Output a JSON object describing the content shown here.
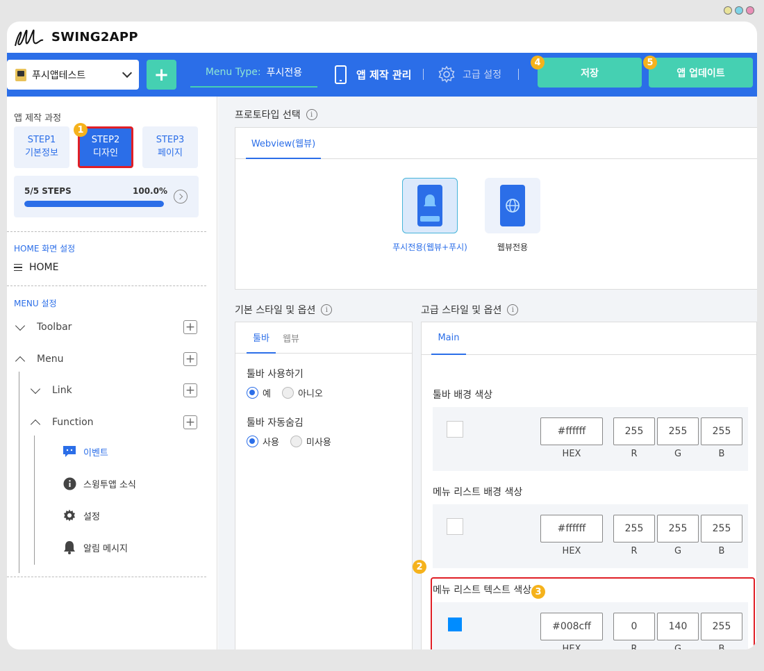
{
  "window": {
    "dot_colors": [
      "#e9e39a",
      "#7fd3e6",
      "#e98fb7"
    ]
  },
  "brand": {
    "name": "SWING2APP"
  },
  "topnav": {
    "app_name": "푸시앱테스트",
    "add_label": "+",
    "menu_type_label": "Menu Type:",
    "menu_type_value": "푸시전용",
    "manage_label": "앱 제작 관리",
    "advanced_label": "고급 설정",
    "save_label": "저장",
    "update_label": "앱 업데이트",
    "accent": "#2b6ee8",
    "button_color": "#45d0b2"
  },
  "badges": [
    "1",
    "2",
    "3",
    "4",
    "5"
  ],
  "sidebar": {
    "process_title": "앱 제작 과정",
    "steps": [
      {
        "line1": "STEP1",
        "line2": "기본정보"
      },
      {
        "line1": "STEP2",
        "line2": "디자인"
      },
      {
        "line1": "STEP3",
        "line2": "페이지"
      }
    ],
    "progress_steps": "5/5 STEPS",
    "progress_percent": "100.0%",
    "progress_value": 1.0,
    "home_section": "HOME 화면 설정",
    "home_item": "HOME",
    "menu_section": "MENU 설정",
    "tree": {
      "toolbar": "Toolbar",
      "menu": "Menu",
      "link": "Link",
      "function": "Function"
    },
    "leaves": [
      {
        "label": "이벤트",
        "icon": "chat-bubble-icon"
      },
      {
        "label": "스윙투앱 소식",
        "icon": "info-circle-icon"
      },
      {
        "label": "설정",
        "icon": "gear-icon"
      },
      {
        "label": "알림 메시지",
        "icon": "bell-icon"
      }
    ]
  },
  "prototype": {
    "title": "프로토타입 선택",
    "tab": "Webview(웹뷰)",
    "options": [
      {
        "label": "푸시전용(웹뷰+푸시)",
        "icon": "push-phone-icon"
      },
      {
        "label": "웹뷰전용",
        "icon": "globe-phone-icon"
      }
    ]
  },
  "basic": {
    "title": "기본 스타일 및 옵션",
    "tabs": [
      "툴바",
      "웹뷰"
    ],
    "toolbar_use_label": "툴바 사용하기",
    "toolbar_use_options": [
      "예",
      "아니오"
    ],
    "toolbar_autohide_label": "툴바 자동숨김",
    "toolbar_autohide_options": [
      "사용",
      "미사용"
    ]
  },
  "advanced": {
    "title": "고급 스타일 및 옵션",
    "tab": "Main",
    "field_labels": {
      "hex": "HEX",
      "r": "R",
      "g": "G",
      "b": "B"
    },
    "colors": [
      {
        "label": "툴바 배경 색상",
        "hex": "#ffffff",
        "r": "255",
        "g": "255",
        "b": "255",
        "swatch": "#ffffff"
      },
      {
        "label": "메뉴 리스트 배경 색상",
        "hex": "#ffffff",
        "r": "255",
        "g": "255",
        "b": "255",
        "swatch": "#ffffff"
      },
      {
        "label": "메뉴 리스트 텍스트 색상",
        "hex": "#008cff",
        "r": "0",
        "g": "140",
        "b": "255",
        "swatch": "#008cff"
      }
    ]
  }
}
